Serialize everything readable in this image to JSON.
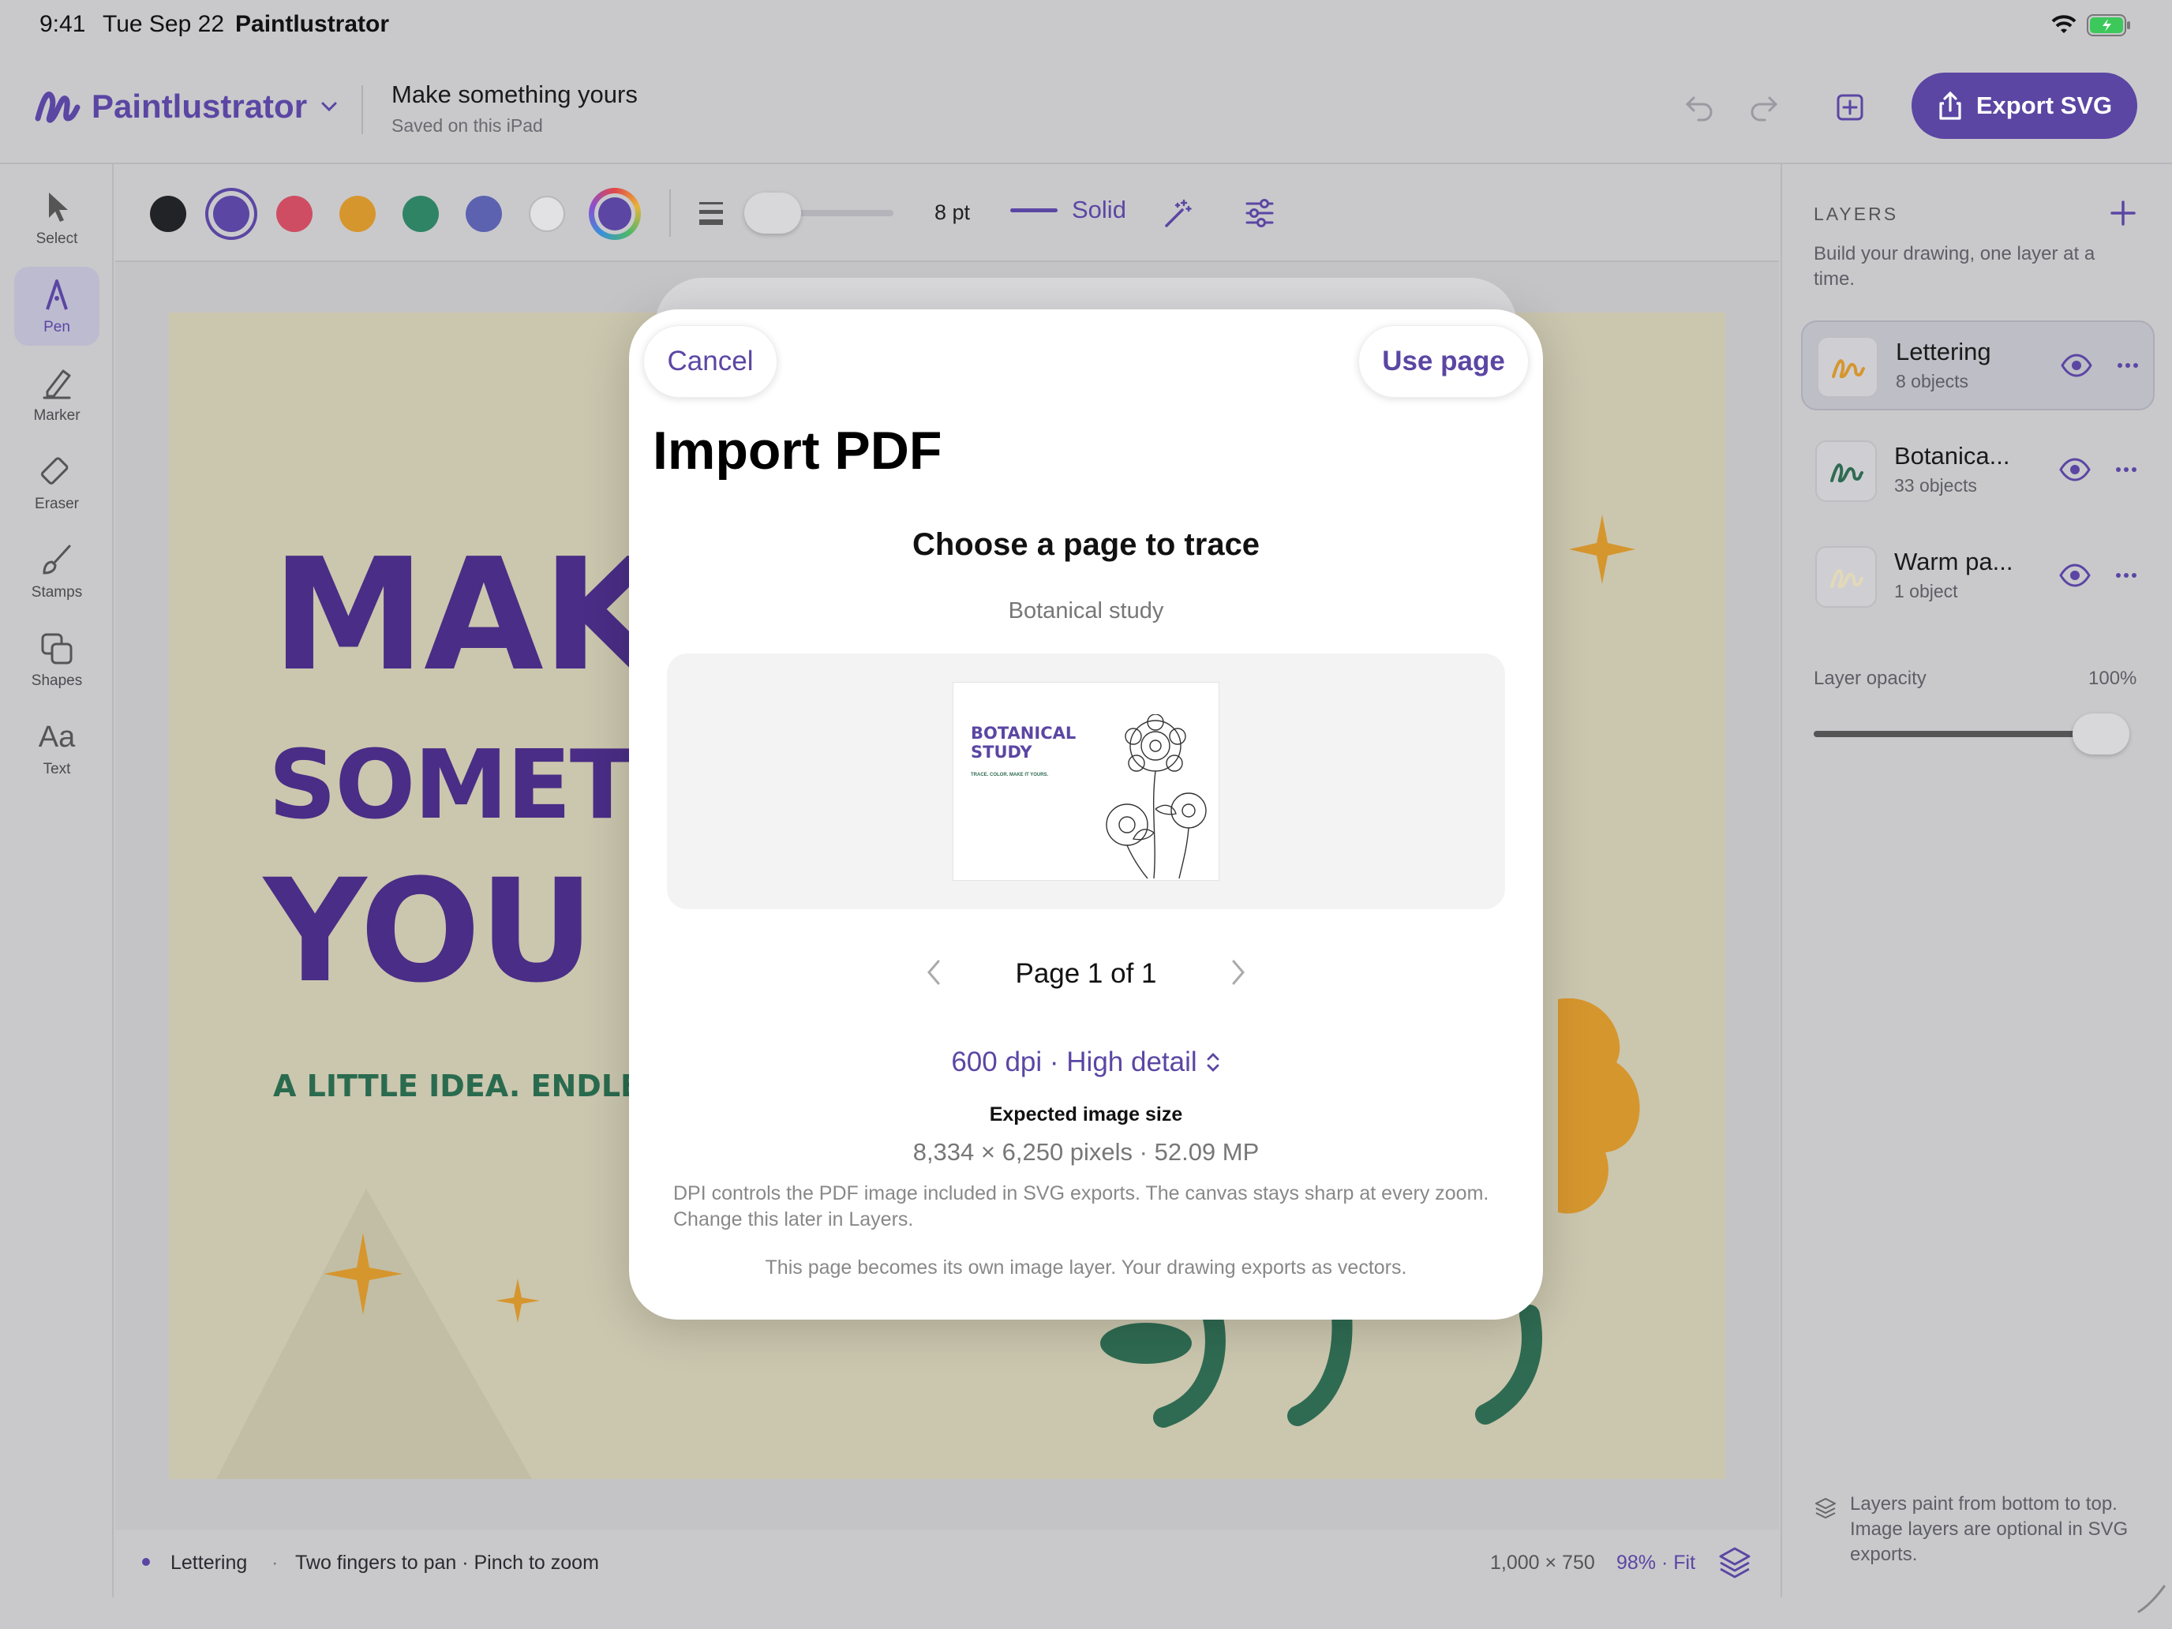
{
  "status_bar": {
    "time": "9:41",
    "date": "Tue Sep 22",
    "app": "Paintlustrator"
  },
  "header": {
    "brand": "Paintlustrator",
    "doc_title": "Make something yours",
    "doc_subtitle": "Saved on this iPad",
    "export_label": "Export SVG"
  },
  "tools": [
    {
      "label": "Select",
      "icon": "arrow-pointer-icon",
      "active": false
    },
    {
      "label": "Pen",
      "icon": "pen-nib-icon",
      "active": true
    },
    {
      "label": "Marker",
      "icon": "marker-icon",
      "active": false
    },
    {
      "label": "Eraser",
      "icon": "eraser-icon",
      "active": false
    },
    {
      "label": "Stamps",
      "icon": "brush-icon",
      "active": false
    },
    {
      "label": "Shapes",
      "icon": "shapes-icon",
      "active": false
    },
    {
      "label": "Text",
      "icon": "text-aa-icon",
      "active": false
    }
  ],
  "toolbar": {
    "swatches": [
      "#222326",
      "#5b46a3",
      "#cf4d63",
      "#d6962e",
      "#2f8465",
      "#5c62b0",
      "#e2e2e4"
    ],
    "selected_swatch": "#5b46a3",
    "stroke_width": "8 pt",
    "stroke_width_level": 0.15,
    "stroke_style": "Solid"
  },
  "canvas": {
    "line1": "MAK",
    "line2": "SOMETI",
    "line3": "YOU",
    "tagline": "A LITTLE IDEA. ENDLESS I"
  },
  "bottom_bar": {
    "active_layer": "Lettering",
    "hint": "Two fingers to pan · Pinch to zoom",
    "canvas_size": "1,000 × 750",
    "zoom": "98% · Fit"
  },
  "layers_panel": {
    "title": "LAYERS",
    "description": "Build your drawing, one layer at a time.",
    "layers": [
      {
        "name": "Lettering",
        "count": "8 objects",
        "selected": true,
        "thumb_color": "#d6962e"
      },
      {
        "name": "Botanica...",
        "count": "33 objects",
        "selected": false,
        "thumb_color": "#2f6b52"
      },
      {
        "name": "Warm pa...",
        "count": "1 object",
        "selected": false,
        "thumb_color": "#e3d9b8"
      }
    ],
    "opacity_label": "Layer opacity",
    "opacity_value": "100%",
    "opacity_level": 1.0,
    "footer": "Layers paint from bottom to top. Image layers are optional in SVG exports."
  },
  "modal": {
    "cancel": "Cancel",
    "use_page": "Use page",
    "title": "Import PDF",
    "subtitle": "Choose a page to trace",
    "file_name": "Botanical study",
    "thumb_title_line1": "BOTANICAL",
    "thumb_title_line2": "STUDY",
    "thumb_tagline": "TRACE. COLOR. MAKE IT YOURS.",
    "pager": "Page 1 of 1",
    "dpi": "600 dpi · High detail",
    "expected_label": "Expected image size",
    "expected_value": "8,334 × 6,250 pixels · 52.09 MP",
    "note1": "DPI controls the PDF image included in SVG exports. The canvas stays sharp at every zoom. Change this later in Layers.",
    "note2": "This page becomes its own image layer. Your drawing exports as vectors."
  },
  "colors": {
    "accent": "#5b46a3",
    "lettering": "#4a2d86",
    "green": "#2f6b52",
    "gold": "#d6962e"
  }
}
